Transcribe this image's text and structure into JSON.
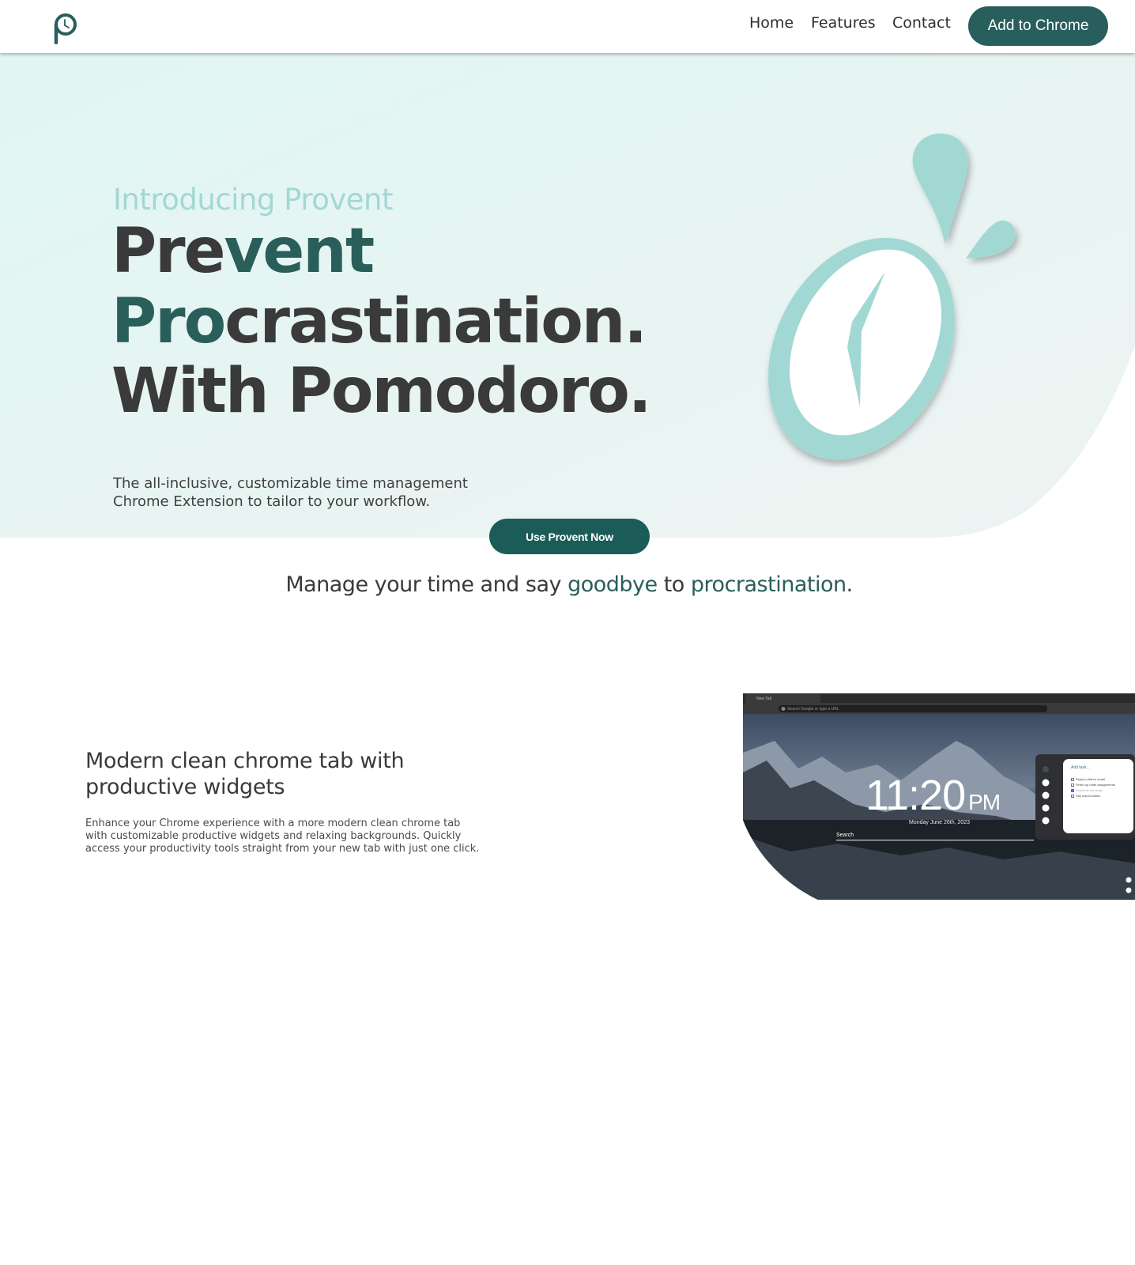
{
  "nav": {
    "logo_icon": "provent-clock-logo",
    "links": [
      "Home",
      "Features",
      "Contact"
    ],
    "cta_label": "Add to Chrome"
  },
  "hero": {
    "kicker": "Introducing Provent",
    "line1_part1": "Pre",
    "line1_accent": "vent",
    "line2_accent": "Pro",
    "line2_part2": "crastination.",
    "line3": "With Pomodoro.",
    "description": "The all-inclusive, customizable time management Chrome Extension to tailor to your workflow.",
    "cta_label": "Use Provent Now",
    "illustration_icon": "stopwatch-drops-illustration"
  },
  "tagline": {
    "part1": "Manage your time and say ",
    "accent1": "goodbye",
    "part2": " to ",
    "accent2": "procrastination",
    "part3": "."
  },
  "feature": {
    "title": "Modern clean chrome tab with productive widgets",
    "description": "Enhance your Chrome experience with a more modern clean chrome tab with customizable productive widgets and relaxing backgrounds. Quickly access your productivity tools straight from your new tab with just one click.",
    "screenshot": {
      "tab_label": "New Tab",
      "url_placeholder": "Search Google or type a URL",
      "clock_time": "11:20",
      "clock_ampm": "PM",
      "date": "Monday June 26th, 2023",
      "search_label": "Search",
      "todo_placeholder": "Add task...",
      "todos": [
        {
          "text": "Reply to Alex's email",
          "done": false
        },
        {
          "text": "Finish up math assignments",
          "done": false
        },
        {
          "text": "Schedule meetings",
          "done": true
        },
        {
          "text": "Pay school tuition",
          "done": false
        }
      ]
    }
  },
  "colors": {
    "brand_dark": "#285f5c",
    "brand_light": "#a3d8d2",
    "hero_bg": "#e4f4f2",
    "text": "#3a3a3a"
  }
}
